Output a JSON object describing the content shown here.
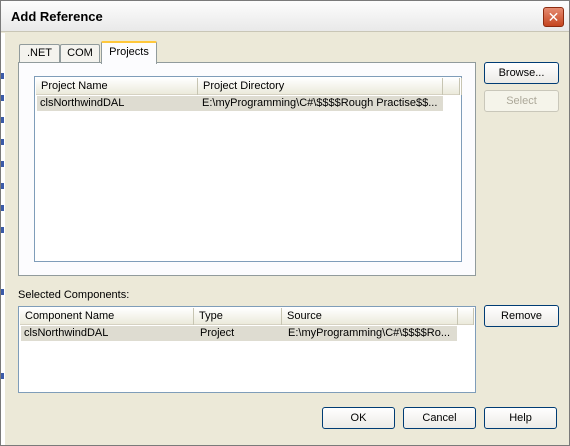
{
  "window": {
    "title": "Add Reference",
    "close_glyph": "✕"
  },
  "tabs": [
    {
      "label": ".NET"
    },
    {
      "label": "COM"
    },
    {
      "label": "Projects",
      "active": true
    }
  ],
  "projects": {
    "columns": [
      "Project Name",
      "Project Directory"
    ],
    "rows": [
      {
        "name": "clsNorthwindDAL",
        "directory": "E:\\myProgramming\\C#\\$$$$Rough Practise$$..."
      }
    ]
  },
  "buttons": {
    "browse": "Browse...",
    "select": "Select",
    "remove": "Remove",
    "ok": "OK",
    "cancel": "Cancel",
    "help": "Help"
  },
  "selected_components": {
    "label": "Selected Components:",
    "columns": [
      "Component Name",
      "Type",
      "Source"
    ],
    "rows": [
      {
        "name": "clsNorthwindDAL",
        "type": "Project",
        "source": "E:\\myProgramming\\C#\\$$$$Ro..."
      }
    ]
  },
  "colors": {
    "dialog_bg": "#ece9d8",
    "selected_row": "#dedcd1",
    "close_button": "#c5451f",
    "tab_highlight": "#ffc83c"
  }
}
